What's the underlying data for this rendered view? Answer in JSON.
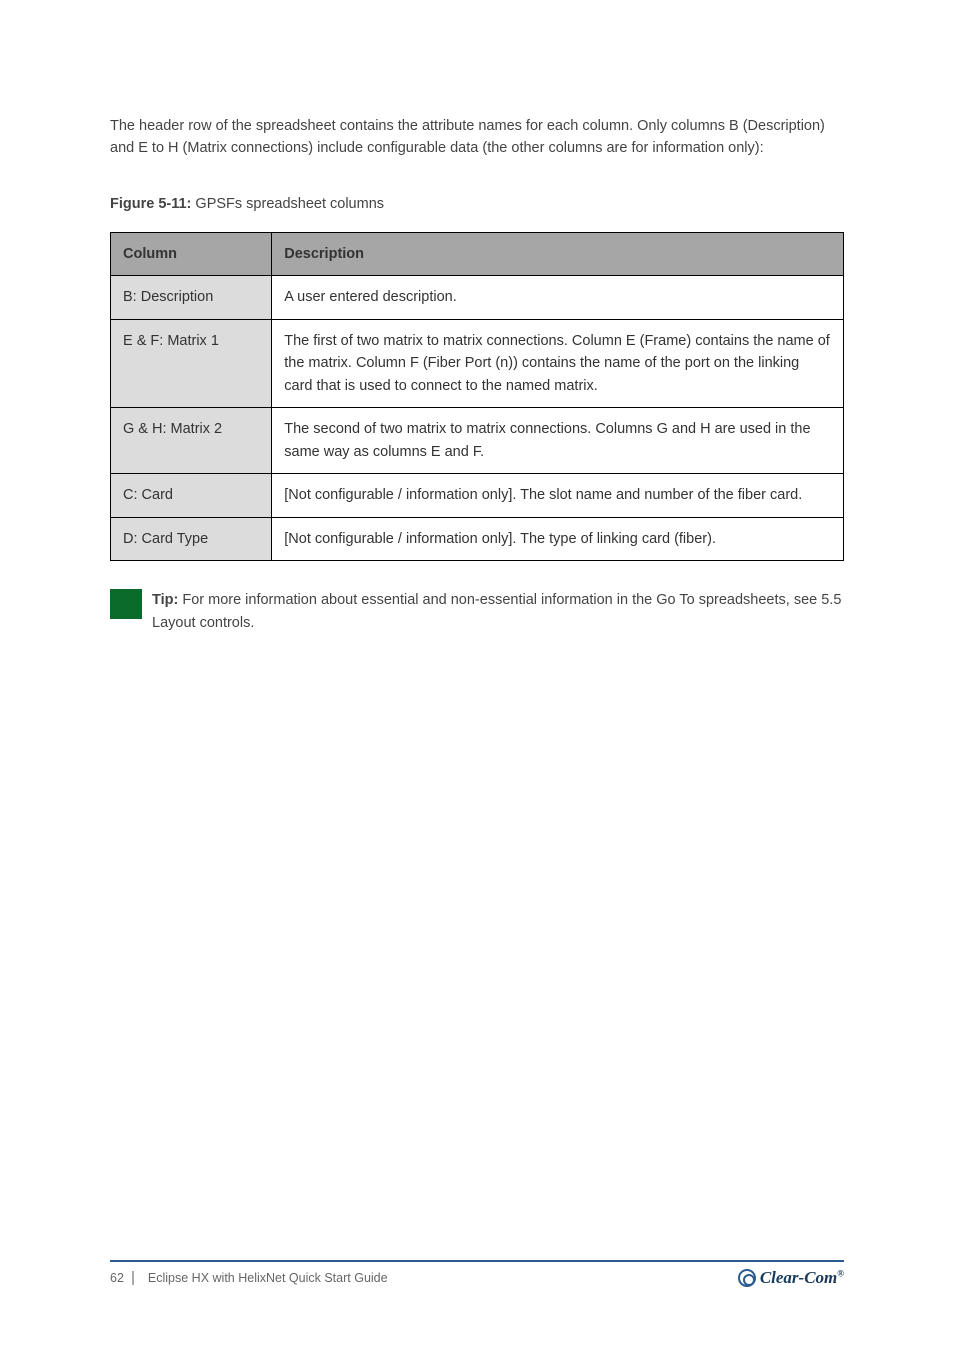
{
  "intro_text": "The header row of the spreadsheet contains the attribute names for each column. Only columns B (Description) and E to H (Matrix connections) include configurable data (the other columns are for information only):",
  "caption_label": "Figure 5-11:",
  "caption_text": " GPSFs spreadsheet columns",
  "table": {
    "headers": [
      "Column",
      "Description"
    ],
    "rows": [
      {
        "key": "B: Description",
        "desc": "A user entered description."
      },
      {
        "key": "E & F: Matrix 1",
        "desc": "The first of two matrix to matrix connections. Column E (Frame) contains the name of the matrix. Column F (Fiber Port (n)) contains the name of the port on the linking card that is used to connect to the named matrix."
      },
      {
        "key": "G & H: Matrix 2",
        "desc": "The second of two matrix to matrix connections. Columns G and H are used in the same way as columns E and F."
      },
      {
        "key": "C: Card",
        "desc": "[Not configurable / information only]. The slot name and number of the fiber card."
      },
      {
        "key": "D: Card Type",
        "desc": "[Not configurable / information only]. The type of linking card (fiber)."
      }
    ]
  },
  "tip_label": "Tip:",
  "tip_text": " For more information about essential and non-essential information in the Go To spreadsheets, see 5.5 Layout controls.",
  "footer": {
    "page_number": "62",
    "title": "Eclipse HX with HelixNet Quick Start Guide",
    "logo_text": "Clear-Com"
  }
}
